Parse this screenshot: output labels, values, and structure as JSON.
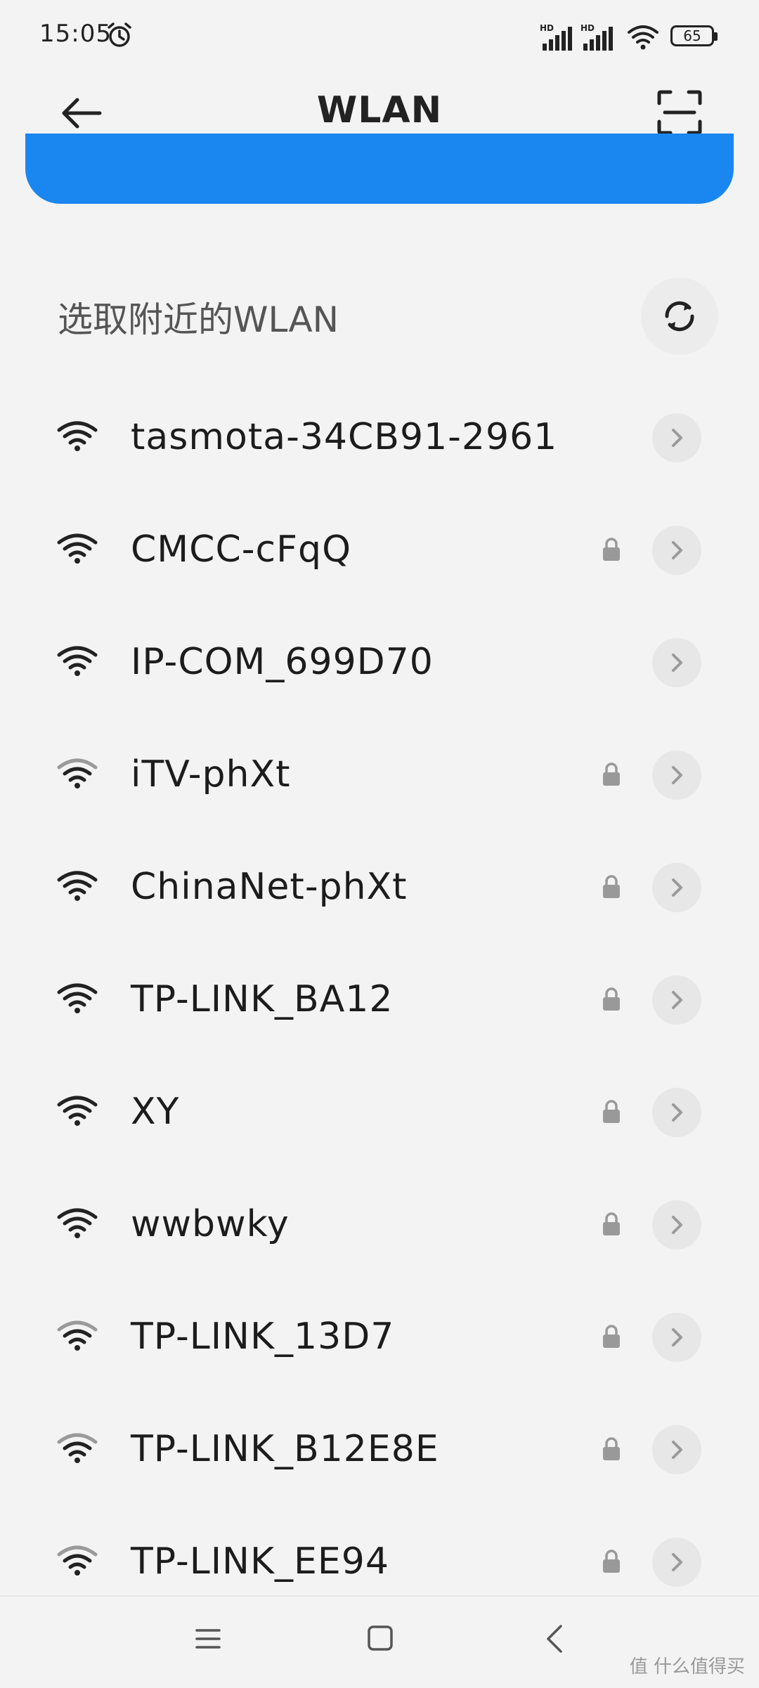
{
  "status_bar": {
    "time": "15:05",
    "battery": "65",
    "icons": [
      "alarm-icon",
      "hd-signal-icon",
      "hd-signal-icon",
      "wifi-icon",
      "battery-icon"
    ]
  },
  "header": {
    "title": "WLAN",
    "back_icon": "back-arrow-icon",
    "scan_icon": "qr-scan-icon"
  },
  "section": {
    "label": "选取附近的WLAN",
    "refresh_icon": "refresh-icon"
  },
  "networks": [
    {
      "ssid": "tasmota-34CB91-2961",
      "locked": false,
      "signal": "strong"
    },
    {
      "ssid": "CMCC-cFqQ",
      "locked": true,
      "signal": "strong"
    },
    {
      "ssid": "IP-COM_699D70",
      "locked": false,
      "signal": "strong"
    },
    {
      "ssid": "iTV-phXt",
      "locked": true,
      "signal": "medium"
    },
    {
      "ssid": "ChinaNet-phXt",
      "locked": true,
      "signal": "strong"
    },
    {
      "ssid": "TP-LINK_BA12",
      "locked": true,
      "signal": "strong"
    },
    {
      "ssid": "XY",
      "locked": true,
      "signal": "strong"
    },
    {
      "ssid": "wwbwky",
      "locked": true,
      "signal": "strong"
    },
    {
      "ssid": "TP-LINK_13D7",
      "locked": true,
      "signal": "medium"
    },
    {
      "ssid": "TP-LINK_B12E8E",
      "locked": true,
      "signal": "medium"
    },
    {
      "ssid": "TP-LINK_EE94",
      "locked": true,
      "signal": "medium"
    }
  ],
  "colors": {
    "accent": "#1a86f0",
    "background": "#f3f3f3"
  },
  "watermark": "值 什么值得买"
}
